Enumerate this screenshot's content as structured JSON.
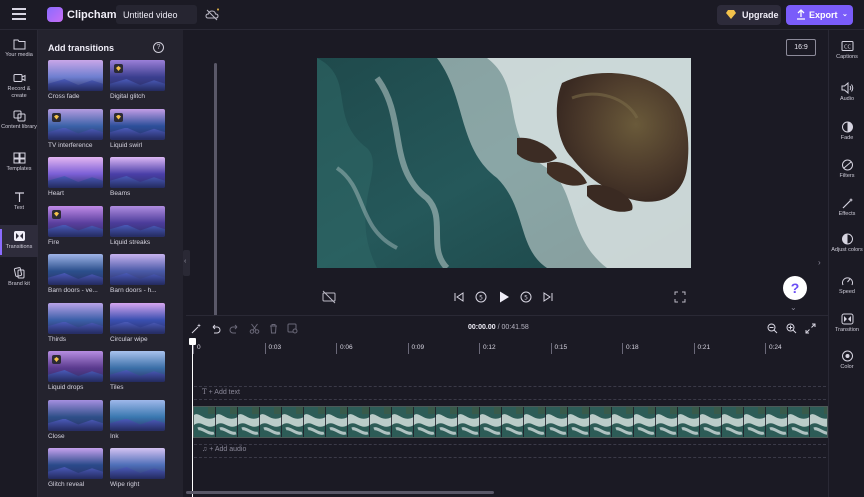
{
  "topbar": {
    "app_name": "Clipchamp",
    "video_title": "Untitled video",
    "upgrade_label": "Upgrade",
    "export_label": "Export"
  },
  "leftnav": {
    "items": [
      {
        "label": "Your media",
        "icon": "folder-icon"
      },
      {
        "label": "Record & create",
        "icon": "camera-icon"
      },
      {
        "label": "Content library",
        "icon": "library-icon"
      },
      {
        "label": "Templates",
        "icon": "templates-icon"
      },
      {
        "label": "Text",
        "icon": "text-icon"
      },
      {
        "label": "Transitions",
        "icon": "transitions-icon",
        "active": true
      },
      {
        "label": "Brand kit",
        "icon": "brand-kit-icon"
      }
    ]
  },
  "panel": {
    "title": "Add transitions",
    "help": "?",
    "tiles": [
      {
        "label": "Cross fade",
        "premium": false
      },
      {
        "label": "Digital glitch",
        "premium": true
      },
      {
        "label": "TV interference",
        "premium": true
      },
      {
        "label": "Liquid swirl",
        "premium": true
      },
      {
        "label": "Heart",
        "premium": false
      },
      {
        "label": "Beams",
        "premium": false
      },
      {
        "label": "Fire",
        "premium": true
      },
      {
        "label": "Liquid streaks",
        "premium": false
      },
      {
        "label": "Barn doors - ve...",
        "premium": false
      },
      {
        "label": "Barn doors - h...",
        "premium": false
      },
      {
        "label": "Thirds",
        "premium": false
      },
      {
        "label": "Circular wipe",
        "premium": false
      },
      {
        "label": "Liquid drops",
        "premium": true
      },
      {
        "label": "Tiles",
        "premium": false
      },
      {
        "label": "Close",
        "premium": false
      },
      {
        "label": "Ink",
        "premium": false
      },
      {
        "label": "Glitch reveal",
        "premium": false
      },
      {
        "label": "Wipe right",
        "premium": false
      }
    ]
  },
  "preview": {
    "aspect_ratio": "16:9",
    "help_button": "?"
  },
  "rightnav": {
    "items": [
      {
        "label": "Captions",
        "icon": "captions-icon"
      },
      {
        "label": "Audio",
        "icon": "audio-icon"
      },
      {
        "label": "Fade",
        "icon": "fade-icon"
      },
      {
        "label": "Filters",
        "icon": "filters-icon"
      },
      {
        "label": "Effects",
        "icon": "effects-icon"
      },
      {
        "label": "Adjust colors",
        "icon": "adjust-colors-icon"
      },
      {
        "label": "Speed",
        "icon": "speed-icon"
      },
      {
        "label": "Transition",
        "icon": "transition-icon"
      },
      {
        "label": "Color",
        "icon": "color-icon"
      }
    ]
  },
  "timeline": {
    "current_time": "00:00.00",
    "total_time": "/ 00:41.58",
    "ruler": [
      "0",
      "0:03",
      "0:06",
      "0:09",
      "0:12",
      "0:15",
      "0:18",
      "0:21",
      "0:24"
    ],
    "add_text": "+ Add text",
    "add_audio": "+ Add audio"
  },
  "colors": {
    "accent": "#7a5cfa",
    "background": "#1b1a24",
    "panel": "#24232e"
  }
}
